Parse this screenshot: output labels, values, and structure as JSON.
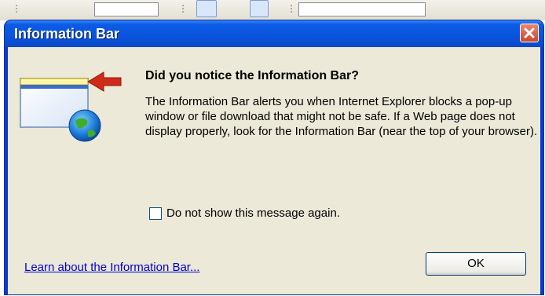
{
  "dialog": {
    "title": "Information Bar",
    "heading": "Did you notice the Information Bar?",
    "body": "The Information Bar alerts you when Internet Explorer blocks a pop-up window or file download that might not be safe. If a Web page does not display properly, look for the Information Bar (near the top of your browser).",
    "checkbox_label": "Do not show this message again.",
    "checkbox_checked": false,
    "link_label": "Learn about the Information Bar...",
    "ok_label": "OK"
  },
  "colors": {
    "titlebar": "#0a54db",
    "client_bg": "#ece9d8",
    "close_button": "#c8452a",
    "link": "#0000cc"
  },
  "icons": {
    "illustration": "information-bar-illustration-icon",
    "close": "close-icon"
  }
}
